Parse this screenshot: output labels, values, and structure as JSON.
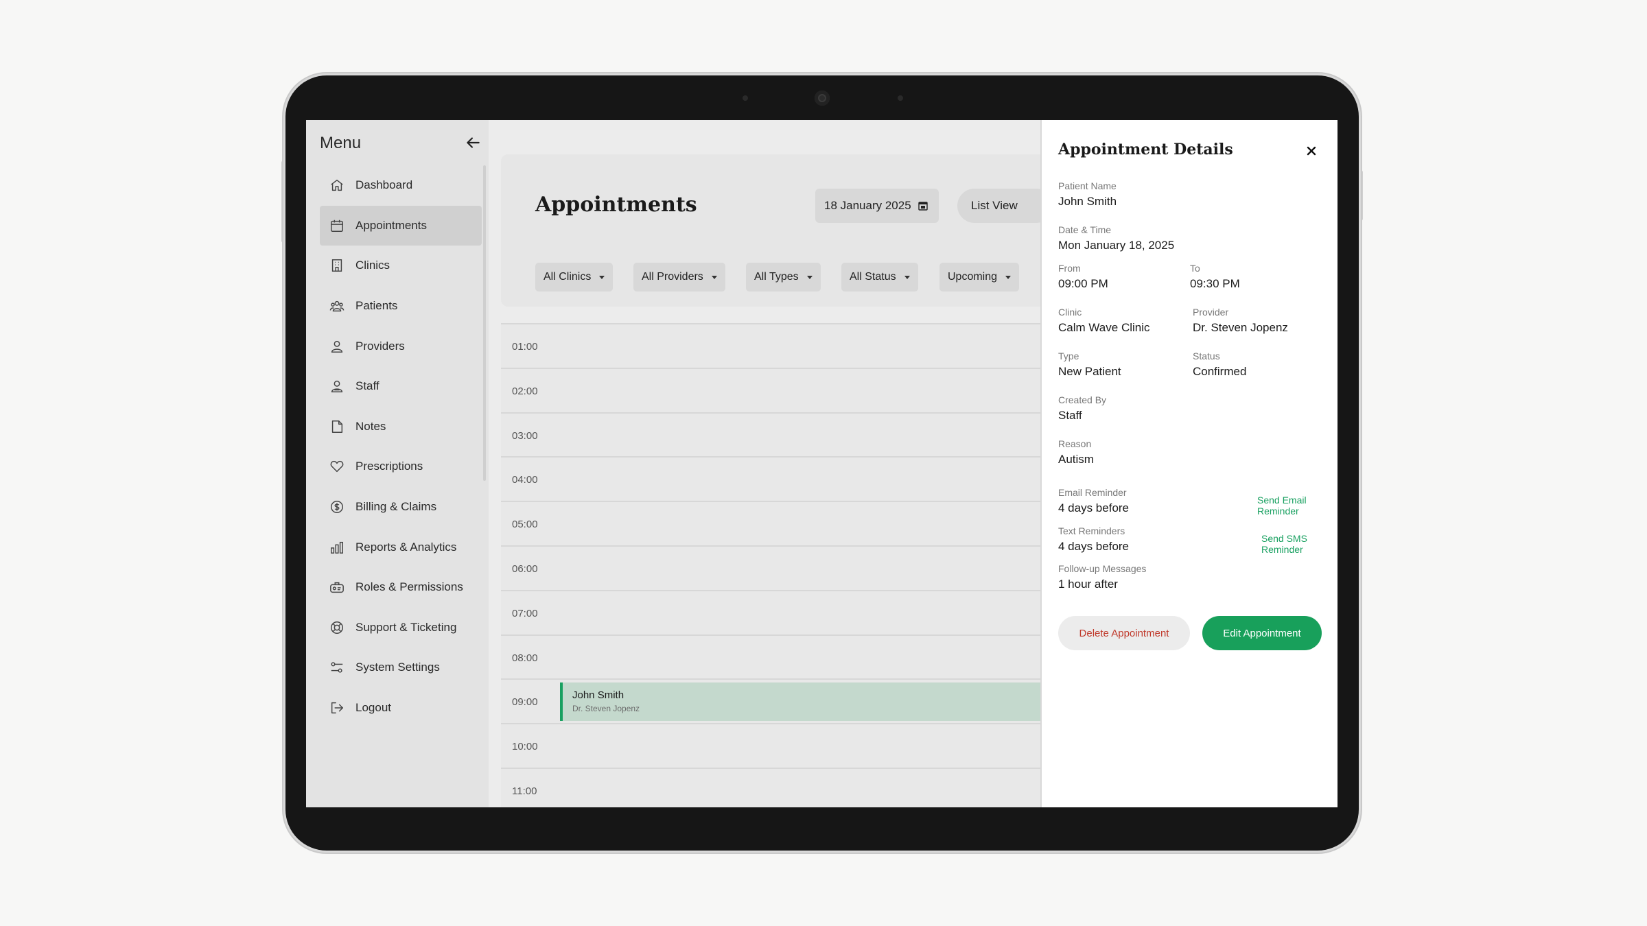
{
  "sidebar": {
    "title": "Menu",
    "items": [
      {
        "label": "Dashboard",
        "icon": "home-icon"
      },
      {
        "label": "Appointments",
        "icon": "calendar-icon",
        "active": true
      },
      {
        "label": "Clinics",
        "icon": "building-icon"
      },
      {
        "label": "Patients",
        "icon": "patients-icon"
      },
      {
        "label": "Providers",
        "icon": "provider-icon"
      },
      {
        "label": "Staff",
        "icon": "staff-icon"
      },
      {
        "label": "Notes",
        "icon": "note-icon"
      },
      {
        "label": "Prescriptions",
        "icon": "heart-icon"
      },
      {
        "label": "Billing & Claims",
        "icon": "dollar-icon"
      },
      {
        "label": "Reports & Analytics",
        "icon": "chart-icon"
      },
      {
        "label": "Roles & Permissions",
        "icon": "roles-icon"
      },
      {
        "label": "Support & Ticketing",
        "icon": "lifebuoy-icon"
      },
      {
        "label": "System Settings",
        "icon": "settings-icon"
      },
      {
        "label": "Logout",
        "icon": "logout-icon"
      }
    ]
  },
  "header": {
    "title": "Appointments",
    "date": "18 January 2025",
    "view": "List View",
    "filters": [
      "All Clinics",
      "All Providers",
      "All Types",
      "All Status",
      "Upcoming"
    ]
  },
  "timeline": {
    "hours": [
      "01:00",
      "02:00",
      "03:00",
      "04:00",
      "05:00",
      "06:00",
      "07:00",
      "08:00",
      "09:00",
      "10:00",
      "11:00"
    ],
    "event": {
      "hour": "09:00",
      "name": "John Smith",
      "provider": "Dr. Steven Jopenz"
    }
  },
  "details": {
    "title": "Appointment Details",
    "patient_name_label": "Patient Name",
    "patient_name": "John Smith",
    "datetime_label": "Date & Time",
    "datetime": "Mon January 18, 2025",
    "from_label": "From",
    "from": "09:00 PM",
    "to_label": "To",
    "to": "09:30 PM",
    "clinic_label": "Clinic",
    "clinic": "Calm Wave Clinic",
    "provider_label": "Provider",
    "provider": "Dr. Steven Jopenz",
    "type_label": "Type",
    "type": "New Patient",
    "status_label": "Status",
    "status": "Confirmed",
    "created_by_label": "Created By",
    "created_by": "Staff",
    "reason_label": "Reason",
    "reason": "Autism",
    "email_reminder_label": "Email Reminder",
    "email_reminder": "4 days before",
    "send_email": "Send Email Reminder",
    "text_reminders_label": "Text Reminders",
    "text_reminders": "4 days before",
    "send_sms": "Send SMS Reminder",
    "followup_label": "Follow-up Messages",
    "followup": "1 hour after",
    "delete_label": "Delete Appointment",
    "edit_label": "Edit Appointment"
  },
  "colors": {
    "accent": "#18a05b",
    "danger": "#c0392b",
    "event_bg": "#c4d9cd"
  }
}
